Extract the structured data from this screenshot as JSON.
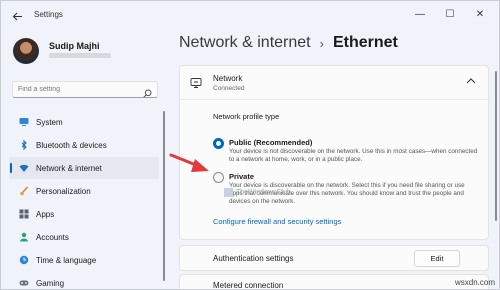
{
  "window": {
    "app_title": "Settings",
    "controls": [
      "—",
      "☐",
      "✕"
    ]
  },
  "profile": {
    "name": "Sudip Majhi",
    "sub": "                    "
  },
  "search": {
    "placeholder": "Find a setting"
  },
  "sidebar": {
    "items": [
      {
        "label": "System",
        "icon": "monitor-icon"
      },
      {
        "label": "Bluetooth & devices",
        "icon": "bluetooth-icon"
      },
      {
        "label": "Network & internet",
        "icon": "wifi-icon",
        "active": true
      },
      {
        "label": "Personalization",
        "icon": "brush-icon"
      },
      {
        "label": "Apps",
        "icon": "apps-icon"
      },
      {
        "label": "Accounts",
        "icon": "person-icon"
      },
      {
        "label": "Time & language",
        "icon": "globe-clock-icon"
      },
      {
        "label": "Gaming",
        "icon": "gamepad-icon"
      }
    ]
  },
  "breadcrumb": {
    "parent": "Network & internet",
    "separator": "›",
    "current": "Ethernet"
  },
  "network": {
    "title": "Network",
    "status": "Connected",
    "profile_type_label": "Network profile type",
    "public": {
      "title": "Public (Recommended)",
      "desc": "Your device is not discoverable on the network. Use this in most cases—when connected to a network at home, work, or in a public place.",
      "checked": true
    },
    "private": {
      "title": "Private",
      "desc": "Your device is discoverable on the network. Select this if you need file sharing or use apps that communicate over this network. You should know and trust the people and devices on the network.",
      "checked": false
    },
    "firewall_link": "Configure firewall and security settings"
  },
  "auth": {
    "label": "Authentication settings",
    "button": "Edit"
  },
  "metered": {
    "label": "Metered connection"
  },
  "watermark": "TheWindowsClub",
  "site_mark": "wsxdn.com",
  "colors": {
    "accent": "#0067c0",
    "arrow": "#e03a3a"
  }
}
